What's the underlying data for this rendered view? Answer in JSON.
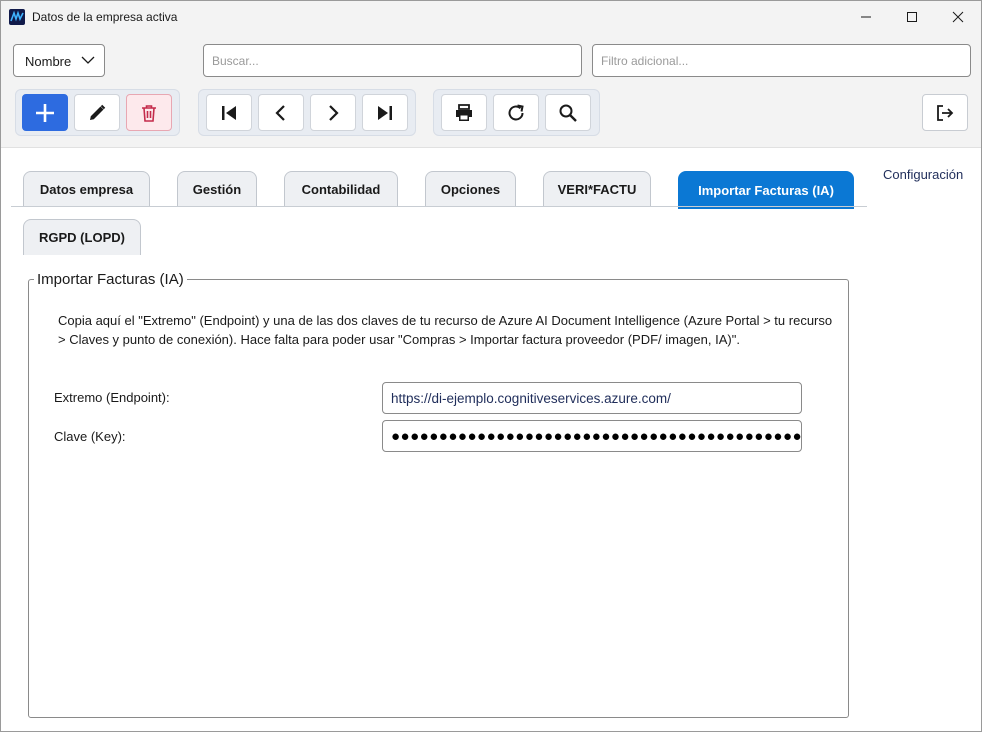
{
  "window": {
    "title": "Datos de la empresa activa"
  },
  "toolbar": {
    "order_combo_value": "Nombre",
    "search_placeholder": "Buscar...",
    "filter_placeholder": "Filtro adicional..."
  },
  "icons": {
    "add": "plus-icon",
    "edit": "pencil-icon",
    "delete": "trash-icon",
    "first": "first-record-icon",
    "prev": "chevron-left-icon",
    "next": "chevron-right-icon",
    "last": "last-record-icon",
    "print": "printer-icon",
    "refresh": "refresh-icon",
    "search": "magnifier-icon",
    "exit": "exit-icon"
  },
  "tabs": [
    {
      "label": "Datos empresa"
    },
    {
      "label": "Gestión"
    },
    {
      "label": "Contabilidad"
    },
    {
      "label": "Opciones"
    },
    {
      "label": "VERI*FACTU"
    },
    {
      "label": "Importar Facturas (IA)"
    },
    {
      "label": "RGPD (LOPD)"
    }
  ],
  "active_tab": "Importar Facturas (IA)",
  "config_link": "Configuración",
  "panel": {
    "legend": "Importar Facturas (IA)",
    "description": "Copia aquí el \"Extremo\" (Endpoint) y una de las dos claves de tu recurso de Azure AI Document Intelligence (Azure Portal > tu recurso > Claves y punto de conexión). Hace falta para poder usar \"Compras > Importar factura proveedor (PDF/ imagen, IA)\".",
    "endpoint_label": "Extremo (Endpoint):",
    "endpoint_value": "https://di-ejemplo.cognitiveservices.azure.com/",
    "key_label": "Clave (Key):",
    "key_value": "●●●●●●●●●●●●●●●●●●●●●●●●●●●●●●●●●●●●●●●●●●●●●●●●●●●●"
  },
  "colors": {
    "accent": "#0b78d4",
    "primary_button": "#2d6be0",
    "danger": "#c42b4b"
  }
}
